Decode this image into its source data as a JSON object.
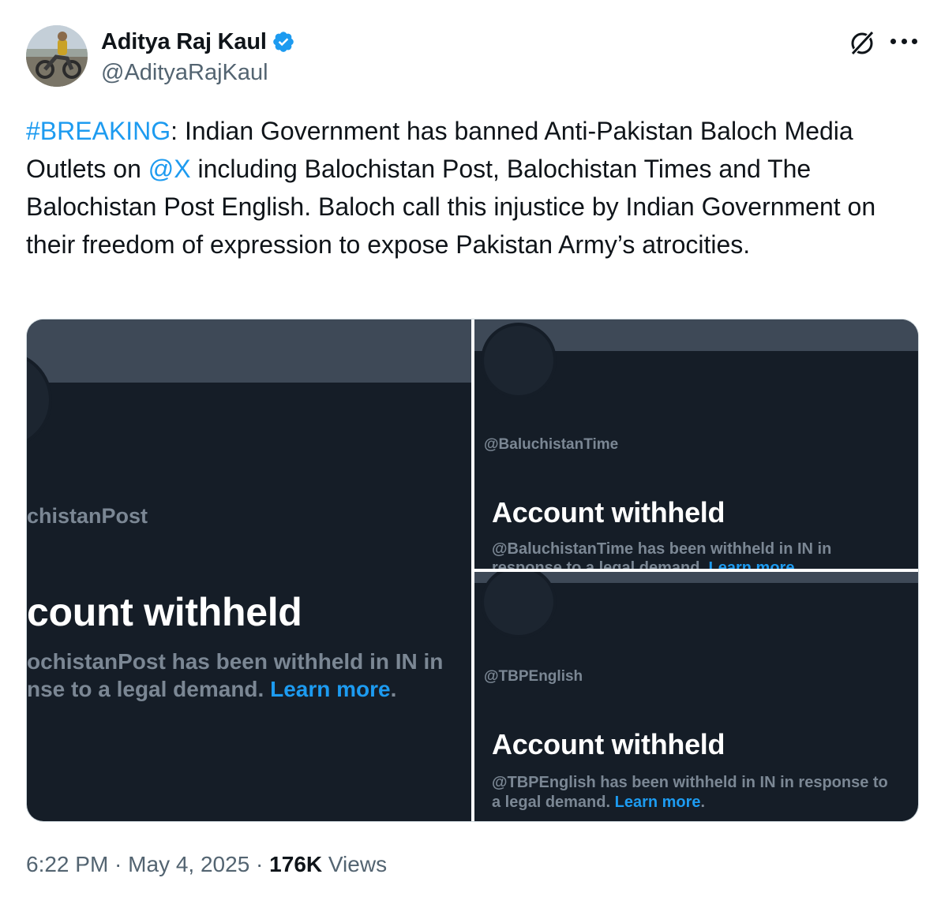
{
  "author": {
    "display_name": "Aditya Raj Kaul",
    "handle": "@AdityaRajKaul",
    "verified": true
  },
  "tweet": {
    "hashtag": "#BREAKING",
    "text_1": ": Indian Government has banned Anti-Pakistan Baloch Media Outlets on ",
    "mention": "@X",
    "text_2": " including Balochistan Post, Balochistan Times and The Balochistan Post English. Baloch call this injustice by Indian Government on their freedom of expression to expose Pakistan Army’s atrocities."
  },
  "media": {
    "left": {
      "handle": "chistanPost",
      "title": "count withheld",
      "desc_line1": "ochistanPost has been withheld in IN in",
      "desc_line2": "nse to a legal demand. ",
      "learn_more": "Learn more",
      "period": "."
    },
    "top_right": {
      "handle": "@BaluchistanTime",
      "title": "Account withheld",
      "desc_line1": "@BaluchistanTime has been withheld in IN in",
      "desc_line2": "response to a legal demand. ",
      "learn_more": "Learn more"
    },
    "bottom_right": {
      "handle": "@TBPEnglish",
      "title": "Account withheld",
      "desc_line1": "@TBPEnglish has been withheld in IN in response to",
      "desc_line2": "a legal demand. ",
      "learn_more": "Learn more",
      "period": "."
    }
  },
  "meta": {
    "time": "6:22 PM",
    "date": "May 4, 2025",
    "separator": " · ",
    "views_count": "176K",
    "views_label": " Views"
  },
  "colors": {
    "link": "#1d9bf0",
    "text": "#0f1419",
    "secondary": "#536471",
    "card_bg": "#151d27",
    "banner": "#3e4957"
  },
  "icons": [
    "verified-badge-icon",
    "grok-icon",
    "more-options-icon"
  ]
}
